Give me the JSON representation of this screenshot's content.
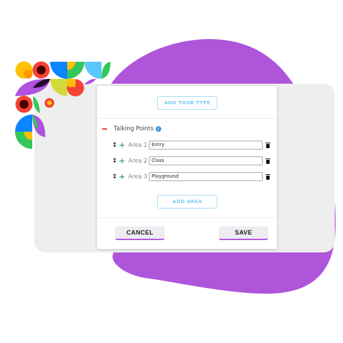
{
  "dialog": {
    "add_tour_type_label": "ADD TOUR TYPE",
    "section": {
      "title": "Talking Points",
      "collapse_icon": "minus-icon",
      "info_icon": "info-icon",
      "info_glyph": "i"
    },
    "areas": [
      {
        "label": "Area 1",
        "value": "Entry"
      },
      {
        "label": "Area 2",
        "value": "Class"
      },
      {
        "label": "Area 3",
        "value": "Playground"
      }
    ],
    "row_icons": {
      "drag": "↕",
      "add": "+",
      "delete": "trash-icon"
    },
    "add_area_label": "ADD AREA",
    "cancel_label": "CANCEL",
    "save_label": "SAVE"
  },
  "colors": {
    "accent_purple": "#af55da",
    "outline_button": "#a6dcf2",
    "minus_red": "#e23b3b",
    "plus_green": "#3aa757",
    "info_blue": "#2f8fe0",
    "panel_grey": "#eeeeee"
  }
}
